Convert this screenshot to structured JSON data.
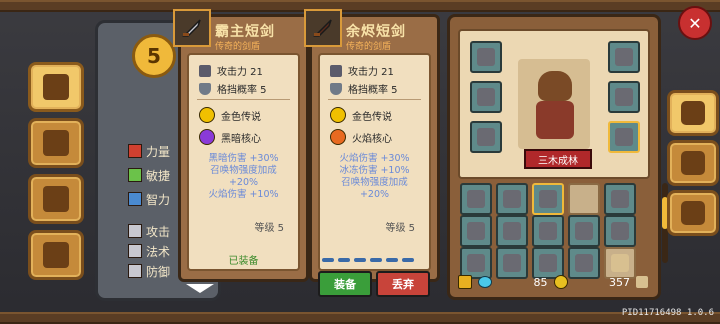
{
  "character": {
    "level": "5",
    "stats": [
      {
        "label": "力量",
        "icon": "fist-icon"
      },
      {
        "label": "敏捷",
        "icon": "feather-icon"
      },
      {
        "label": "智力",
        "icon": "book-icon"
      },
      {
        "label": "攻击",
        "icon": "sword-icon"
      },
      {
        "label": "法术",
        "icon": "staff-icon"
      },
      {
        "label": "防御",
        "icon": "shield-icon"
      }
    ]
  },
  "equipped_item": {
    "name": "霸主短剑",
    "rarity": "传奇的剑盾",
    "attack_label": "攻击力 21",
    "parry_label": "格挡概率 5",
    "set_label": "金色传说",
    "core_label": "黑暗核心",
    "effects": [
      "黑暗伤害 +30%",
      "召唤物强度加成",
      "+20%",
      "火焰伤害 +10%"
    ],
    "level_label": "等级 5",
    "status": "已装备"
  },
  "compare_item": {
    "name": "余烬短剑",
    "rarity": "传奇的剑盾",
    "attack_label": "攻击力 21",
    "parry_label": "格挡概率 5",
    "set_label": "金色传说",
    "core_label": "火焰核心",
    "effects": [
      "火焰伤害 +30%",
      "冰冻伤害 +10%",
      "召唤物强度加成",
      "+20%"
    ],
    "level_label": "等级 5",
    "equip_button": "装备",
    "discard_button": "丢弃"
  },
  "inventory": {
    "character_name": "三木成林",
    "gem_count": "85",
    "gold_count": "357",
    "scroll_fraction": 0.3
  },
  "footer": {
    "pid": "PID11716498 1.0.6"
  },
  "colors": {
    "card_bg": "#9a6d46",
    "accent_gold": "#f0b93a",
    "equip_green": "#3a9e3a",
    "discard_red": "#c8443a"
  }
}
